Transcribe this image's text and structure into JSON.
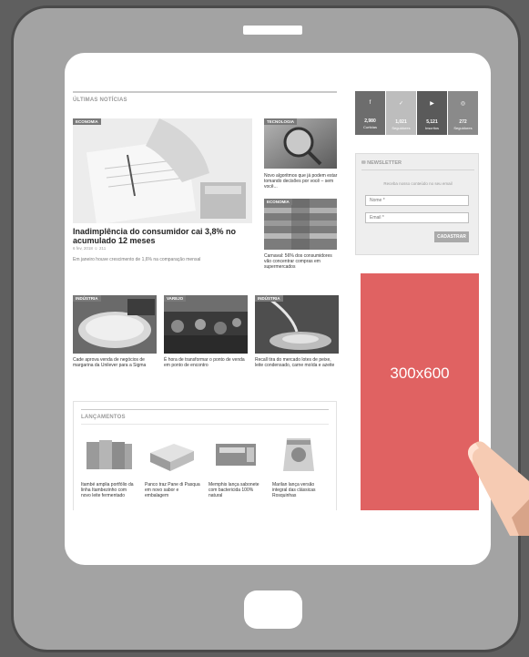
{
  "latest": {
    "title": "ÚLTIMAS NOTÍCIAS",
    "main": {
      "tag": "ECONOMIA",
      "headline": "Inadimplência do consumidor cai 3,8% no acumulado 12 meses",
      "meta": "6 fev, 2018   ☺ 211",
      "summary": "Em janeiro houve crescimento de 1,6% na comparação mensal"
    },
    "side": [
      {
        "tag": "TECNOLOGIA",
        "headline": "Novo algoritmos que já podem estar tomando decisões por você – sem você..."
      },
      {
        "tag": "ECONOMIA",
        "headline": "Carnaval: 56% dos consumidores vão concentrar compras em supermercados"
      }
    ],
    "row": [
      {
        "tag": "INDÚSTRIA",
        "headline": "Cade aprova venda de negócios de margarina da Unilever para a Sigma"
      },
      {
        "tag": "VAREJO",
        "headline": "É hora de transformar o ponto de venda em ponto de encontro"
      },
      {
        "tag": "INDÚSTRIA",
        "headline": "Recall tira do mercado lotes de peixe, leite condensado, carne moída e azeite"
      }
    ]
  },
  "launches": {
    "title": "LANÇAMENTOS",
    "items": [
      {
        "caption": "Itambé amplia portfólio da linha Itambezinho com novo leite fermentado"
      },
      {
        "caption": "Panco traz Pane di Pasqua em novo sabor e embalagem"
      },
      {
        "caption": "Memphis lança sabonete com bactericida 100% natural"
      },
      {
        "caption": "Marilan lança versão integral das clássicas Rosquinhas"
      }
    ]
  },
  "social": [
    {
      "icon": "f",
      "count": "2,980",
      "label": "Curtidas",
      "color": "#6d6d6d"
    },
    {
      "icon": "✓",
      "count": "1,021",
      "label": "Seguidores",
      "color": "#bdbdbd"
    },
    {
      "icon": "▶",
      "count": "5,121",
      "label": "Inscritos",
      "color": "#5a5a5a"
    },
    {
      "icon": "◎",
      "count": "272",
      "label": "Seguidores",
      "color": "#8a8a8a"
    }
  ],
  "newsletter": {
    "title": "✉ NEWSLETTER",
    "desc": "Receba nosso conteúdo no seu email",
    "name_placeholder": "Nome *",
    "email_placeholder": "Email *",
    "button": "CADASTRAR"
  },
  "ad": {
    "label": "300x600",
    "color": "#e06262"
  }
}
